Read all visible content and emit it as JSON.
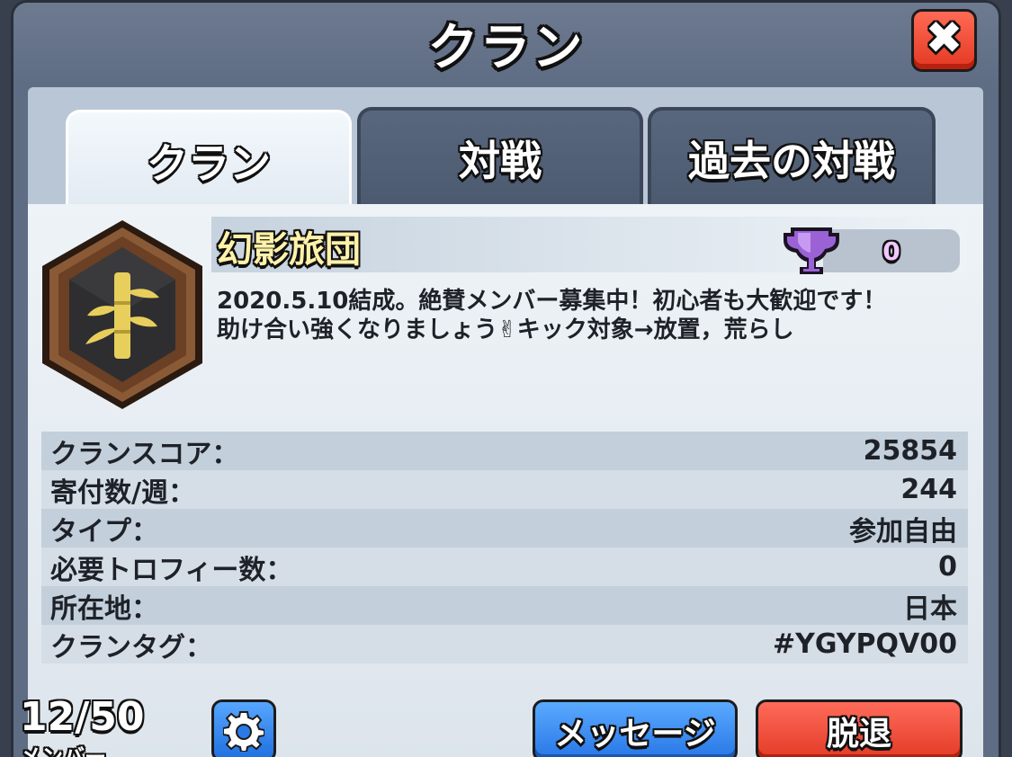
{
  "window": {
    "title": "クラン"
  },
  "close_button": {
    "label": "✖"
  },
  "tabs": [
    {
      "label": "クラン",
      "active": true
    },
    {
      "label": "対戦",
      "active": false
    },
    {
      "label": "過去の対戦",
      "active": false
    }
  ],
  "clan": {
    "name": "幻影旅団",
    "trophies": "0",
    "description_line1": "2020.5.10結成。絶賛メンバー募集中！初心者も大歓迎です！",
    "description_line2": "助け合い強くなりましょう✌キック対象→放置，荒らし",
    "badge_icon": "bamboo-badge-icon",
    "trophy_icon": "purple-trophy-icon"
  },
  "stats": [
    {
      "label": "クランスコア：",
      "value": "25854"
    },
    {
      "label": "寄付数/週：",
      "value": "244"
    },
    {
      "label": "タイプ：",
      "value": "参加自由"
    },
    {
      "label": "必要トロフィー数：",
      "value": "0"
    },
    {
      "label": "所在地：",
      "value": "日本"
    },
    {
      "label": "クランタグ：",
      "value": "#YGYPQV00"
    }
  ],
  "footer": {
    "member_count": "12/50",
    "member_label": "メンバー",
    "settings_icon": "gear-icon",
    "message_button": "メッセージ",
    "leave_button": "脱退"
  },
  "colors": {
    "accent_blue": "#2776e6",
    "accent_red": "#e23a26",
    "clan_name": "#fff2a8"
  }
}
